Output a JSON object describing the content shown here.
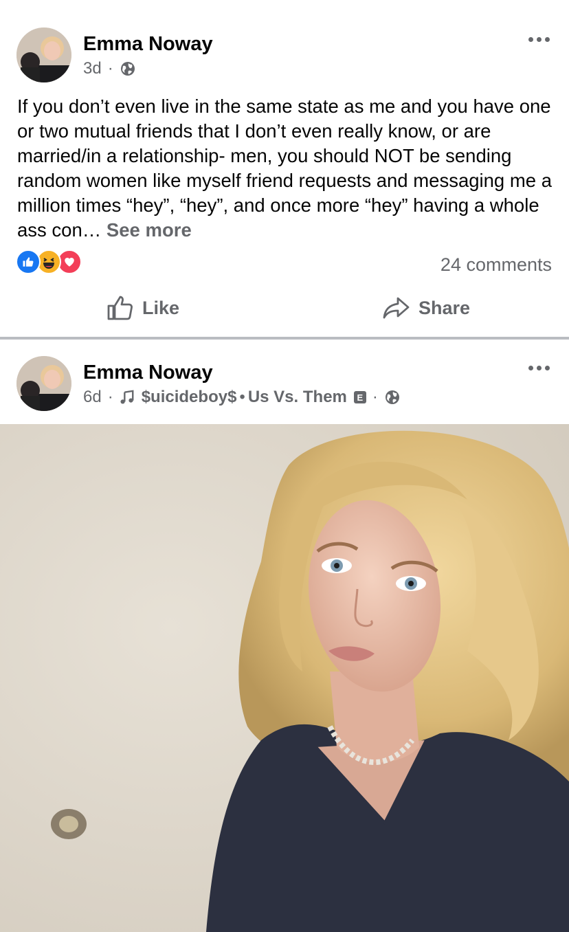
{
  "post1": {
    "author": "Emma Noway",
    "time": "3d",
    "separator": "·",
    "privacy_icon": "globe-icon",
    "text": "If you don’t even live in the same state as me and you have one or two mutual friends that I don’t even really know, or are married/in a relationship- men, you should NOT be sending random women like myself friend requests and messaging me a million times “hey”, “hey”, and once more “hey” having a whole ass con… ",
    "see_more": "See more",
    "reactions": [
      "like-reaction-icon",
      "haha-reaction-icon",
      "love-reaction-icon"
    ],
    "comments": "24 comments",
    "like_label": "Like",
    "share_label": "Share"
  },
  "post2": {
    "author": "Emma Noway",
    "time": "6d",
    "separator": "·",
    "song": "$uicideboy$",
    "song_separator": "•",
    "song_title": "Us Vs. Them",
    "explicit_badge": "E",
    "privacy_icon": "globe-icon"
  },
  "colors": {
    "secondary_text": "#65676b",
    "primary_text": "#050505",
    "like_blue": "#1877f2",
    "love_red": "#f33e58",
    "haha_yellow": "#f7b125",
    "divider": "#b9bcc1"
  }
}
